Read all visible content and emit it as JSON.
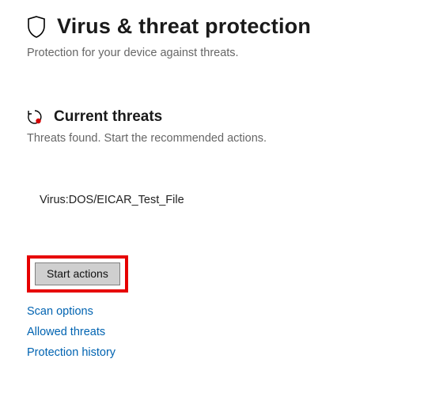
{
  "header": {
    "title": "Virus & threat protection",
    "subtitle": "Protection for your device against threats."
  },
  "section": {
    "title": "Current threats",
    "subtitle": "Threats found. Start the recommended actions."
  },
  "threats": [
    {
      "name": "Virus:DOS/EICAR_Test_File"
    }
  ],
  "actions": {
    "start_button": "Start actions"
  },
  "links": {
    "scan_options": "Scan options",
    "allowed_threats": "Allowed threats",
    "protection_history": "Protection history"
  }
}
